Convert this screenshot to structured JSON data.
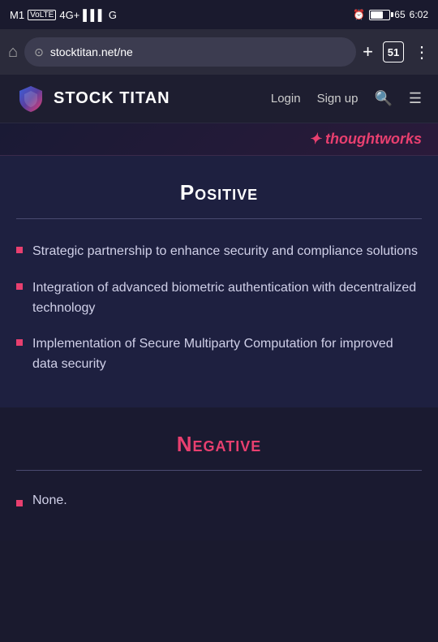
{
  "status_bar": {
    "carrier": "M1",
    "network_type": "VoLTE",
    "signal": "4G+",
    "time": "6:02"
  },
  "browser": {
    "url": "stocktitan.net/ne",
    "tab_count": "51",
    "add_label": "+",
    "menu_label": "⋮",
    "home_label": "⌂"
  },
  "nav": {
    "logo_alt": "Stock Titan Shield Logo",
    "title": "STOCK TITAN",
    "login": "Login",
    "signup": "Sign up"
  },
  "thoughtworks": {
    "logo_text": "✦ thoughtworks"
  },
  "positive_section": {
    "title": "Positive",
    "bullets": [
      "Strategic partnership to enhance security and compliance solutions",
      "Integration of advanced biometric authentication with decentralized technology",
      "Implementation of Secure Multiparty Computation for improved data security"
    ]
  },
  "negative_section": {
    "title": "Negative",
    "bullets": [
      "None."
    ]
  }
}
